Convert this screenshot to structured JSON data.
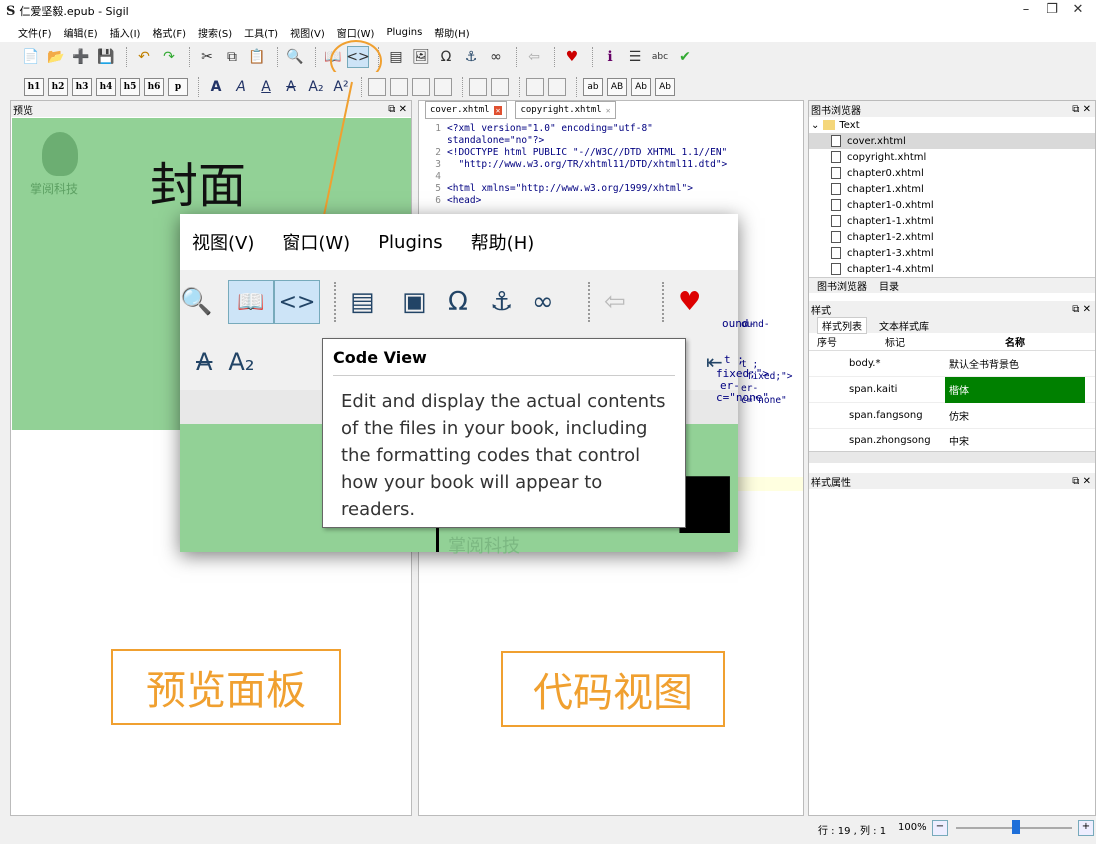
{
  "app": {
    "logo": "S",
    "title": "仁爱坚毅.epub - Sigil",
    "minimize": "–",
    "restore": "❐",
    "close": "✕"
  },
  "menu": [
    "文件(F)",
    "编辑(E)",
    "插入(I)",
    "格式(F)",
    "搜索(S)",
    "工具(T)",
    "视图(V)",
    "窗口(W)",
    "Plugins",
    "帮助(H)"
  ],
  "heading_buttons": [
    "h1",
    "h2",
    "h3",
    "h4",
    "h5",
    "h6",
    "p"
  ],
  "case_buttons": [
    "ab",
    "AB",
    "Ab",
    "Ab"
  ],
  "preview": {
    "header": "预览",
    "brand": "掌阅科技",
    "cover_title": "封面",
    "label": "预览面板"
  },
  "code": {
    "tabs": [
      "cover.xhtml",
      "copyright.xhtml"
    ],
    "lines": [
      {
        "n": "1",
        "t": "<?xml version=\"1.0\" encoding=\"utf-8\""
      },
      {
        "n": "",
        "t": "standalone=\"no\"?>"
      },
      {
        "n": "2",
        "t": "<!DOCTYPE html PUBLIC \"-//W3C//DTD XHTML 1.1//EN\""
      },
      {
        "n": "3",
        "t": "  \"http://www.w3.org/TR/xhtml11/DTD/xhtml11.dtd\">"
      },
      {
        "n": "4",
        "t": ""
      },
      {
        "n": "5",
        "t": "<html xmlns=\"http://www.w3.org/1999/xhtml\">"
      },
      {
        "n": "6",
        "t": "<head>"
      }
    ],
    "frag1": "ound-",
    "frag2": "t ;",
    "frag3": " fixed;\">",
    "frag4": "er-",
    "frag5": "c=\"none\"",
    "label": "代码视图"
  },
  "browser": {
    "header": "图书浏览器",
    "folder": "Text",
    "files": [
      "cover.xhtml",
      "copyright.xhtml",
      "chapter0.xhtml",
      "chapter1.xhtml",
      "chapter1-0.xhtml",
      "chapter1-1.xhtml",
      "chapter1-2.xhtml",
      "chapter1-3.xhtml",
      "chapter1-4.xhtml"
    ],
    "tabs": [
      "图书浏览器",
      "目录"
    ]
  },
  "styles": {
    "header": "样式",
    "tabs": [
      "样式列表",
      "文本样式库"
    ],
    "cols": [
      "序号",
      "标记",
      "名称"
    ],
    "rows": [
      {
        "tag": "body.*",
        "name": "默认全书背景色"
      },
      {
        "tag": "span.kaiti",
        "name": "楷体"
      },
      {
        "tag": "span.fangsong",
        "name": "仿宋"
      },
      {
        "tag": "span.zhongsong",
        "name": "中宋"
      }
    ],
    "selected_color": "#008000"
  },
  "props": {
    "header": "样式属性"
  },
  "status": {
    "pos": "行 : 19 , 列 : 1",
    "zoom": "100%"
  },
  "zoom_callout": {
    "menu": [
      "视图(V)",
      "窗口(W)",
      "Plugins",
      "帮助(H)"
    ],
    "omega": "Ω",
    "anchor": "⚓",
    "link": "∞",
    "tooltip_title": "Code View",
    "tooltip_body": "Edit and display the actual contents of the files in your book, including the formatting codes that control how your book will appear to readers.",
    "brand_frag": "掌阅科技",
    "frag_code": "ound-",
    "frag_t": "t ;",
    "frag_fixed": "fixed;\">",
    "frag_er": "er-",
    "frag_none": "c=\"none\""
  },
  "accent": "#f0a030"
}
